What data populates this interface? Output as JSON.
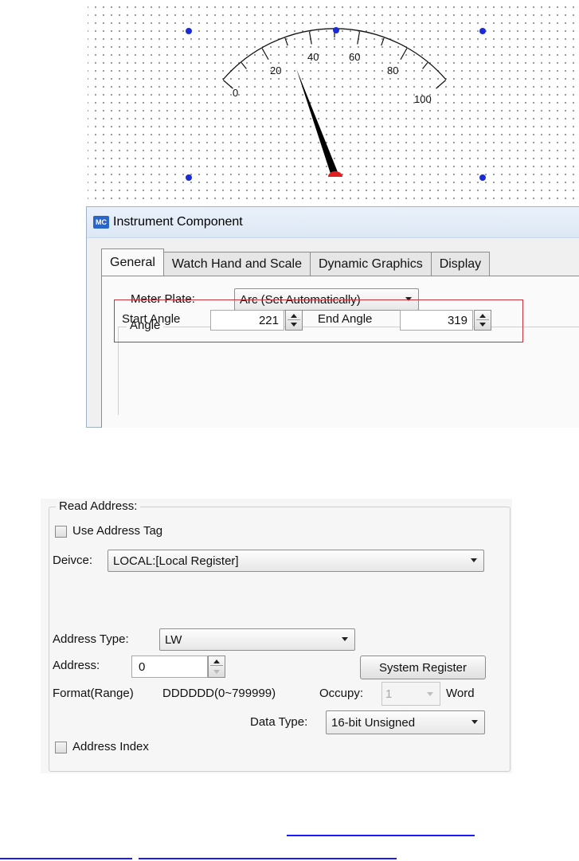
{
  "gauge": {
    "scale_labels": [
      "0",
      "20",
      "40",
      "60",
      "80",
      "100"
    ],
    "colors": {
      "needle": "#000000",
      "pivot": "#e02020",
      "handles": "#1a2bd6"
    }
  },
  "dialog": {
    "icon_text": "MC",
    "title": "Instrument Component",
    "tabs": [
      "General",
      "Watch Hand and Scale",
      "Dynamic Graphics",
      "Display"
    ],
    "active_tab": "General",
    "meter_plate_label": "Meter Plate:",
    "meter_plate_value": "Arc (Set Automatically)",
    "angle_group_label": "Angle",
    "start_angle_label": "Start Angle",
    "start_angle_value": "221",
    "end_angle_label": "End Angle",
    "end_angle_value": "319",
    "highlight_color": "#c8343a"
  },
  "read_address": {
    "group_label": "Read Address:",
    "use_address_tag_label": "Use Address Tag",
    "device_label": "Deivce:",
    "device_value": "LOCAL:[Local Register]",
    "address_type_label": "Address Type:",
    "address_type_value": "LW",
    "address_label": "Address:",
    "address_value": "0",
    "system_register_button": "System Register",
    "format_label": "Format(Range)",
    "format_value": "DDDDDD(0~799999)",
    "occupy_label": "Occupy:",
    "occupy_value": "1",
    "occupy_unit": "Word",
    "data_type_label": "Data Type:",
    "data_type_value": "16-bit Unsigned",
    "address_index_label": "Address Index"
  },
  "links": {
    "color": "#1a1aff"
  }
}
